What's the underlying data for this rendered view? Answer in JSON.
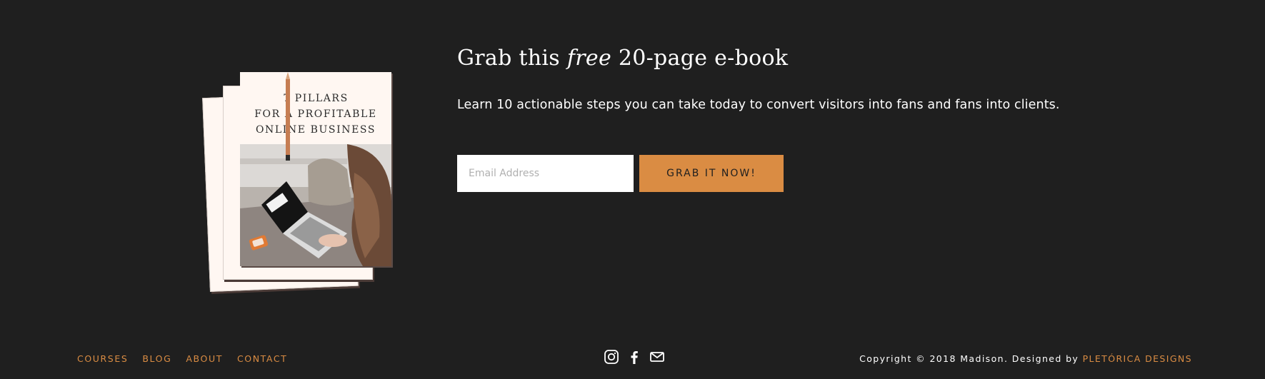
{
  "ebook": {
    "cover_lines": [
      "7 PILLARS",
      "FOR A PROFITABLE",
      "ONLINE BUSINESS"
    ]
  },
  "optin": {
    "headline_before": "Grab this ",
    "headline_emphasis": "free",
    "headline_after": " 20-page e-book",
    "subtext": "Learn 10 actionable steps you can take today to convert visitors into fans and fans into clients.",
    "email_placeholder": "Email Address",
    "button_label": "GRAB IT NOW!"
  },
  "footer": {
    "nav": {
      "courses": "COURSES",
      "blog": "BLOG",
      "about": "ABOUT",
      "contact": "CONTACT"
    },
    "social_icons": [
      "instagram-icon",
      "facebook-icon",
      "email-icon"
    ],
    "copyright_text": "Copyright © 2018 Madison. Designed by ",
    "credit_link": "PLETÓRICA DESIGNS"
  },
  "colors": {
    "background": "#1f1f1f",
    "accent": "#da8c43",
    "text": "#ffffff",
    "cover": "#fff7f2"
  }
}
